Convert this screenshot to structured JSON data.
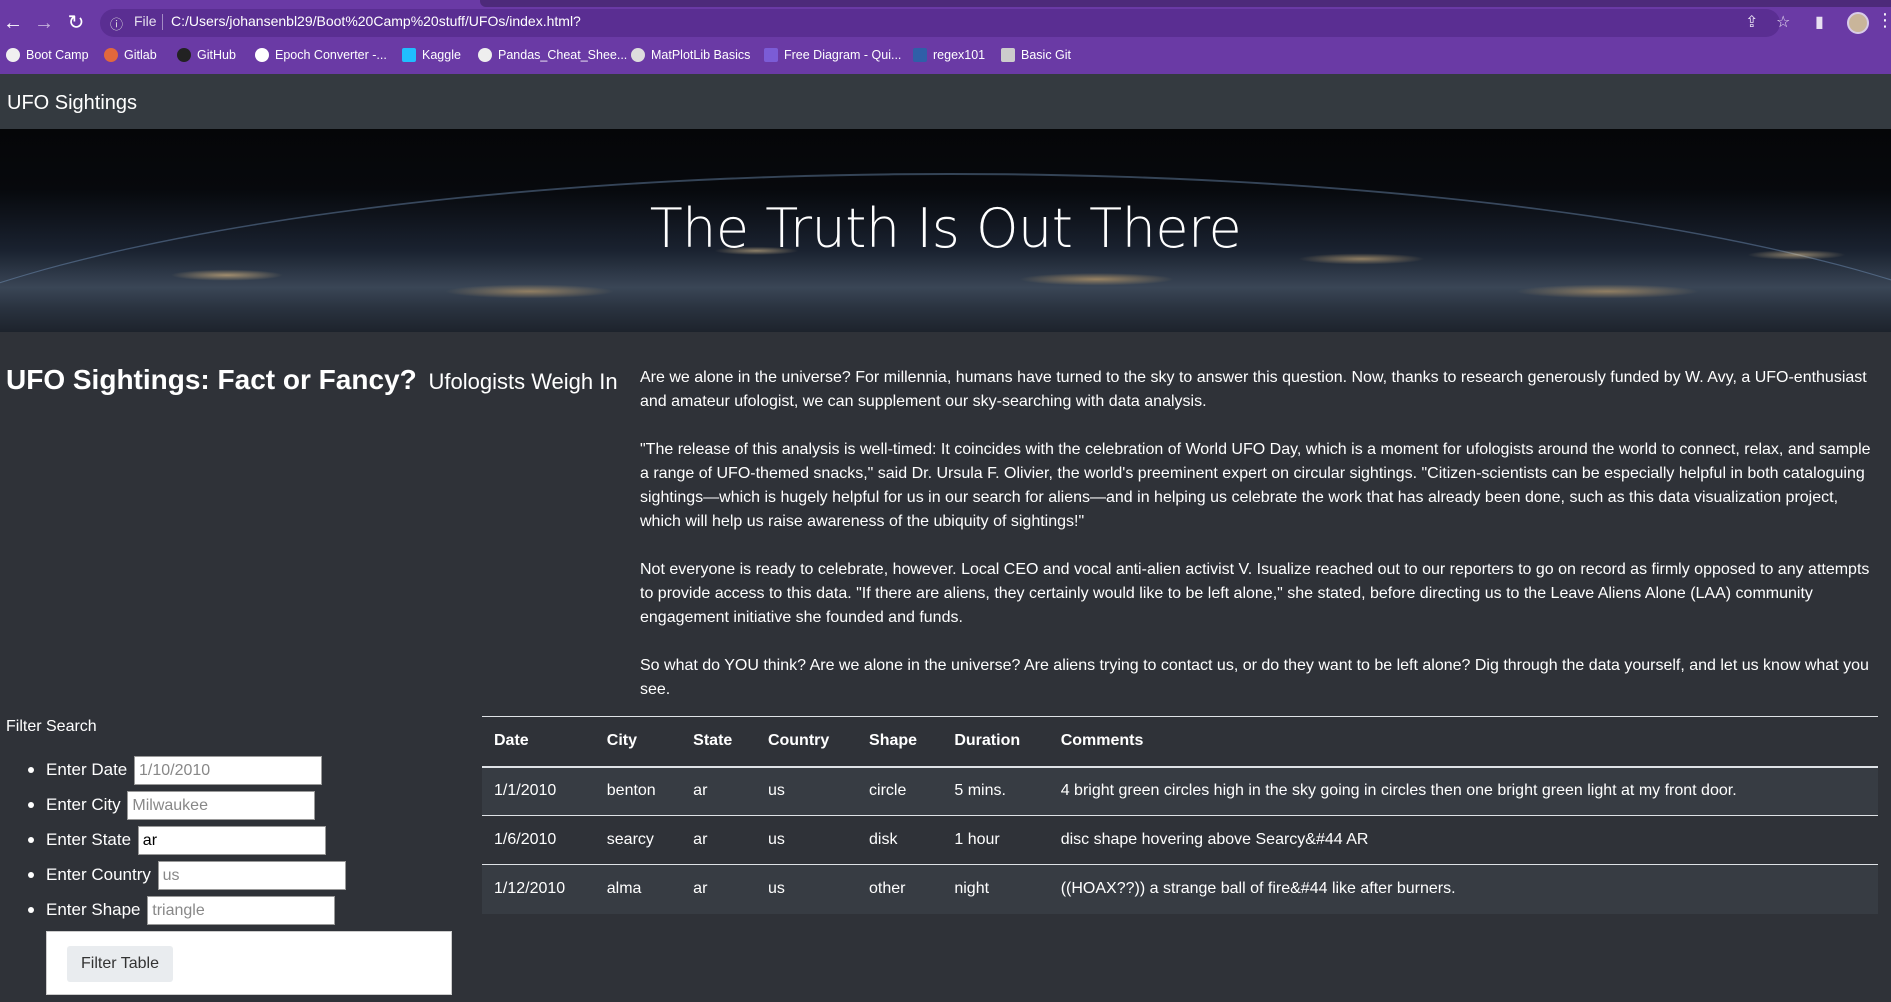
{
  "browser": {
    "info_icon": "info-icon",
    "file_label": "File",
    "url": "C:/Users/johansenbl29/Boot%20Camp%20stuff/UFOs/index.html?",
    "bookmarks": [
      {
        "label": "Boot Camp"
      },
      {
        "label": "Gitlab"
      },
      {
        "label": "GitHub"
      },
      {
        "label": "Epoch Converter -..."
      },
      {
        "label": "Kaggle"
      },
      {
        "label": "Pandas_Cheat_Shee..."
      },
      {
        "label": "MatPlotLib Basics"
      },
      {
        "label": "Free Diagram - Qui..."
      },
      {
        "label": "regex101"
      },
      {
        "label": "Basic Git"
      }
    ]
  },
  "navbar": {
    "brand": "UFO Sightings"
  },
  "hero": {
    "title": "The Truth Is Out There"
  },
  "headline": {
    "main": "UFO Sightings: Fact or Fancy?",
    "sub": "Ufologists Weigh In"
  },
  "article": {
    "paragraphs": [
      "Are we alone in the universe? For millennia, humans have turned to the sky to answer this question. Now, thanks to research generously funded by W. Avy, a UFO-enthusiast and amateur ufologist, we can supplement our sky-searching with data analysis.",
      "\"The release of this analysis is well-timed: It coincides with the celebration of World UFO Day, which is a moment for ufologists around the world to connect, relax, and sample a range of UFO-themed snacks,\" said Dr. Ursula F. Olivier, the world's preeminent expert on circular sightings. \"Citizen-scientists can be especially helpful in both cataloguing sightings—which is hugely helpful for us in our search for aliens—and in helping us celebrate the work that has already been done, such as this data visualization project, which will help us raise awareness of the ubiquity of sightings!\"",
      "Not everyone is ready to celebrate, however. Local CEO and vocal anti-alien activist V. Isualize reached out to our reporters to go on record as firmly opposed to any attempts to provide access to this data. \"If there are aliens, they certainly would like to be left alone,\" she stated, before directing us to the Leave Aliens Alone (LAA) community engagement initiative she founded and funds.",
      "So what do YOU think? Are we alone in the universe? Are aliens trying to contact us, or do they want to be left alone? Dig through the data yourself, and let us know what you see."
    ]
  },
  "filters": {
    "title": "Filter Search",
    "date": {
      "label": "Enter Date",
      "placeholder": "1/10/2010",
      "value": ""
    },
    "city": {
      "label": "Enter City",
      "placeholder": "Milwaukee",
      "value": ""
    },
    "state": {
      "label": "Enter State",
      "placeholder": "",
      "value": "ar"
    },
    "country": {
      "label": "Enter Country",
      "placeholder": "us",
      "value": ""
    },
    "shape": {
      "label": "Enter Shape",
      "placeholder": "triangle",
      "value": ""
    },
    "button": "Filter Table"
  },
  "table": {
    "headers": [
      "Date",
      "City",
      "State",
      "Country",
      "Shape",
      "Duration",
      "Comments"
    ],
    "rows": [
      [
        "1/1/2010",
        "benton",
        "ar",
        "us",
        "circle",
        "5 mins.",
        "4 bright green circles high in the sky going in circles then one bright green light at my front door."
      ],
      [
        "1/6/2010",
        "searcy",
        "ar",
        "us",
        "disk",
        "1 hour",
        "disc shape hovering above Searcy&#44 AR"
      ],
      [
        "1/12/2010",
        "alma",
        "ar",
        "us",
        "other",
        "night",
        "((HOAX??)) a strange ball of fire&#44 like after burners."
      ]
    ]
  }
}
